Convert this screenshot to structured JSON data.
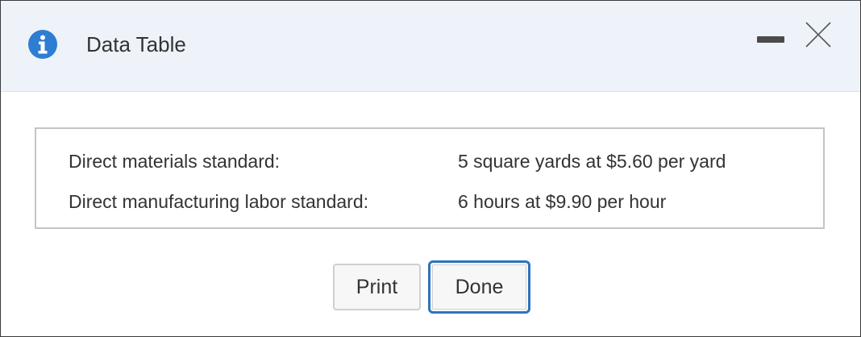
{
  "dialog": {
    "title": "Data Table",
    "info_icon": "info-icon",
    "minimize_icon": "minimize-icon",
    "close_icon": "close-icon"
  },
  "table": {
    "rows": [
      {
        "label": "Direct materials standard:",
        "value": "5 square yards at $5.60 per yard"
      },
      {
        "label": "Direct manufacturing labor standard:",
        "value": "6 hours at $9.90 per hour"
      }
    ]
  },
  "buttons": {
    "print_label": "Print",
    "done_label": "Done"
  },
  "colors": {
    "titlebar_bg": "#eef3fa",
    "info_icon_bg": "#2d7dd2",
    "done_border": "#2e73bd"
  }
}
